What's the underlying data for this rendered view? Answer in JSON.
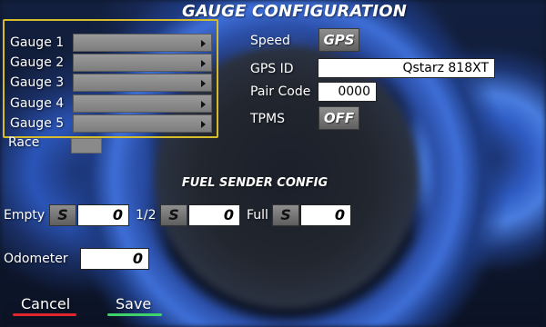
{
  "title": "GAUGE CONFIGURATION",
  "gauges": [
    {
      "label": "Gauge 1",
      "value": ""
    },
    {
      "label": "Gauge 2",
      "value": ""
    },
    {
      "label": "Gauge 3",
      "value": ""
    },
    {
      "label": "Gauge 4",
      "value": ""
    },
    {
      "label": "Gauge 5",
      "value": ""
    }
  ],
  "race_label": "Race",
  "speed": {
    "label": "Speed",
    "value": "GPS"
  },
  "gps_id": {
    "label": "GPS ID",
    "value": "Qstarz 818XT"
  },
  "pair_code": {
    "label": "Pair Code",
    "value": "0000"
  },
  "tpms": {
    "label": "TPMS",
    "value": "OFF"
  },
  "fuel": {
    "title": "FUEL SENDER CONFIG",
    "empty": {
      "label": "Empty",
      "button": "S",
      "value": "0"
    },
    "half": {
      "label": "1/2",
      "button": "S",
      "value": "0"
    },
    "full": {
      "label": "Full",
      "button": "S",
      "value": "0"
    }
  },
  "odometer": {
    "label": "Odometer",
    "value": "0"
  },
  "actions": {
    "cancel": "Cancel",
    "save": "Save"
  },
  "colors": {
    "highlight": "#d6bc2b",
    "cancel_underline": "#e0262b",
    "save_underline": "#3fd26a"
  }
}
